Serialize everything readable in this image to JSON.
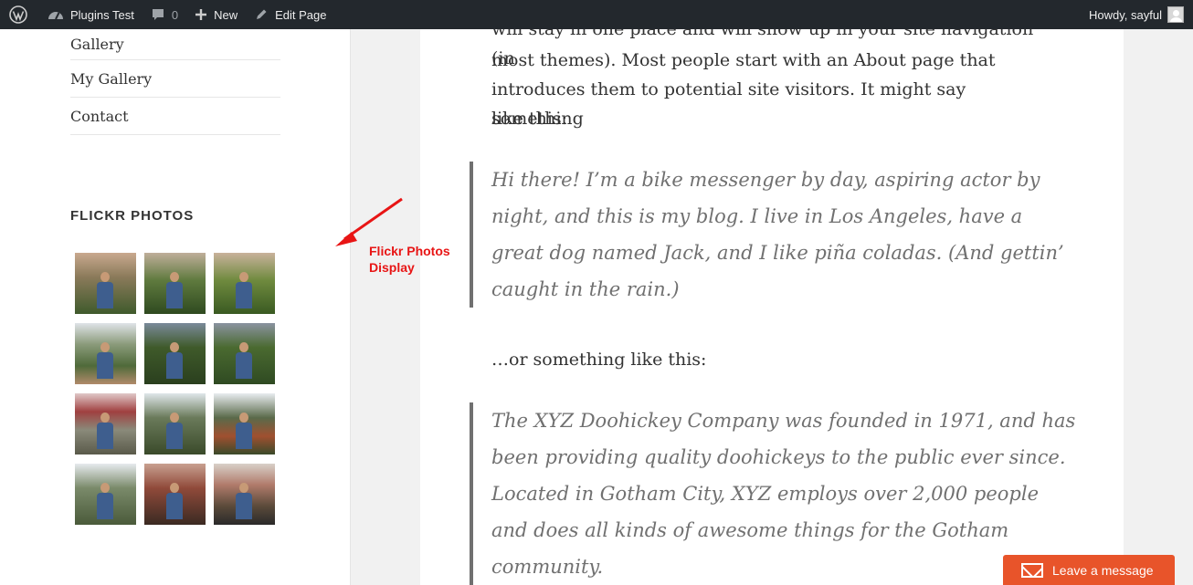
{
  "adminbar": {
    "site": "Plugins Test",
    "comments_count": "0",
    "new_label": "New",
    "edit_label": "Edit Page",
    "howdy": "Howdy, sayful"
  },
  "sidebar": {
    "menu": [
      "Gallery",
      "My Gallery",
      "Contact"
    ],
    "widget_title": "FLICKR PHOTOS"
  },
  "annotation": {
    "line1": "Flickr Photos",
    "line2": "Display",
    "color": "#e81515"
  },
  "content": {
    "para1_line1": "will stay in one place and will show up in your site navigation (in",
    "para1_line2": "most themes). Most people start with an About page that",
    "para1_line3": "introduces them to potential site visitors. It might say something",
    "para1_line4": "like this:",
    "quote1_line1": "Hi there! I’m a bike messenger by day, aspiring actor by",
    "quote1_line2": "night, and this is my blog. I live in Los Angeles, have a",
    "quote1_line3": "great dog named Jack, and I like piña coladas. (And gettin’",
    "quote1_line4": "caught in the rain.)",
    "para2": "…or something like this:",
    "quote2_line1": "The XYZ Doohickey Company was founded in 1971, and has",
    "quote2_line2": "been providing quality doohickeys to the public ever since.",
    "quote2_line3": "Located in Gotham City, XYZ employs over 2,000 people",
    "quote2_line4": "and does all kinds of awesome things for the Gotham",
    "quote2_line5": "community."
  },
  "chat": {
    "label": "Leave a message",
    "color": "#e8542a"
  }
}
